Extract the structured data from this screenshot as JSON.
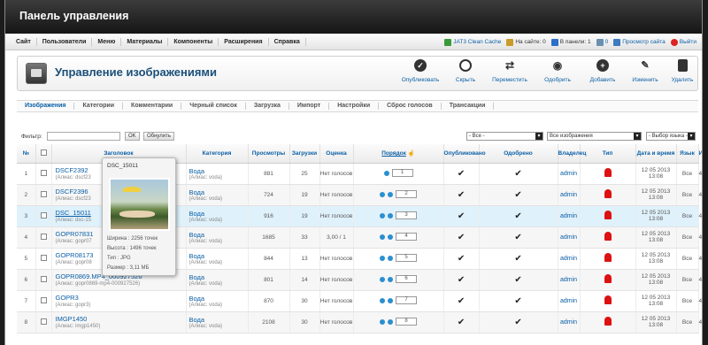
{
  "topbar_title": "Панель управления",
  "menu": [
    "Сайт",
    "Пользователи",
    "Меню",
    "Материалы",
    "Компоненты",
    "Расширения",
    "Справка"
  ],
  "status": {
    "cache": "JAT3 Clean Cache",
    "on_site": "На сайте: 0",
    "in_panel": "В панели: 1",
    "messages": "0",
    "view_site": "Просмотр сайта",
    "logout": "Выйти"
  },
  "page_title": "Управление изображениями",
  "toolbar": {
    "publish": "Опубликовать",
    "hide": "Скрыть",
    "move": "Переместить",
    "approve": "Одобрить",
    "add": "Добавить",
    "edit": "Изменить",
    "delete": "Удалить"
  },
  "subnav": [
    "Изображения",
    "Категории",
    "Комментарии",
    "Черный список",
    "Загрузка",
    "Импорт",
    "Настройки",
    "Сброс голосов",
    "Трансакции"
  ],
  "filter": {
    "label": "Фильтр:",
    "ok": "OK",
    "reset": "Обнулить",
    "sel_all": "- Все -",
    "sel_images": "Все изображения",
    "sel_lang": "- Выбор языка -"
  },
  "columns": {
    "num": "№",
    "title": "Заголовок",
    "category": "Категория",
    "views": "Просмотры",
    "downloads": "Загрузки",
    "rating": "Оценка",
    "order": "Порядок",
    "published": "Опубликовано",
    "approved": "Одобрено",
    "owner": "Владелец",
    "type": "Тип",
    "datetime": "Дата и время",
    "lang": "Язык",
    "id": "ИД"
  },
  "rows": [
    {
      "n": "1",
      "title": "DSCF2392",
      "alias": "(Алиас: dscf23",
      "cat": "Вода",
      "cal": "(Алиас: voda)",
      "views": "881",
      "dl": "25",
      "rating": "Нет голосов",
      "order": "1",
      "owner": "admin",
      "date": "12 05 2013 13:08",
      "lang": "Все",
      "id": "4626"
    },
    {
      "n": "2",
      "title": "DSCF2396",
      "alias": "(Алиас: dscf23",
      "cat": "Вода",
      "cal": "(Алиас: voda)",
      "views": "724",
      "dl": "19",
      "rating": "Нет голосов",
      "order": "2",
      "owner": "admin",
      "date": "12 05 2013 13:08",
      "lang": "Все",
      "id": "4627"
    },
    {
      "n": "3",
      "title": "DSC_15011",
      "alias": "(Алиас: dsc-15",
      "cat": "Вода",
      "cal": "(Алиас: voda)",
      "views": "916",
      "dl": "19",
      "rating": "Нет голосов",
      "order": "3",
      "owner": "admin",
      "date": "12 05 2013 13:08",
      "lang": "Все",
      "id": "4628"
    },
    {
      "n": "4",
      "title": "GOPR07831",
      "alias": "(Алиас: gopr07",
      "cat": "Вода",
      "cal": "(Алиас: voda)",
      "views": "1685",
      "dl": "33",
      "rating": "3,00 / 1",
      "order": "4",
      "owner": "admin",
      "date": "12 05 2013 13:08",
      "lang": "Все",
      "id": "4629"
    },
    {
      "n": "5",
      "title": "GOPR08173",
      "alias": "(Алиас: gopr08",
      "cat": "Вода",
      "cal": "(Алиас: voda)",
      "views": "844",
      "dl": "13",
      "rating": "Нет голосов",
      "order": "5",
      "owner": "admin",
      "date": "12 05 2013 13:08",
      "lang": "Все",
      "id": "4630"
    },
    {
      "n": "6",
      "title": "GOPR0869.MP4_000927526",
      "alias": "(Алиас: gopr0869-mp4-000927526)",
      "cat": "Вода",
      "cal": "(Алиас: voda)",
      "views": "801",
      "dl": "14",
      "rating": "Нет голосов",
      "order": "6",
      "owner": "admin",
      "date": "12 05 2013 13:08",
      "lang": "Все",
      "id": "4631"
    },
    {
      "n": "7",
      "title": "GOPR3",
      "alias": "(Алиас: gopr3)",
      "cat": "Вода",
      "cal": "(Алиас: voda)",
      "views": "870",
      "dl": "30",
      "rating": "Нет голосов",
      "order": "7",
      "owner": "admin",
      "date": "12 05 2013 13:08",
      "lang": "Все",
      "id": "4632"
    },
    {
      "n": "8",
      "title": "IMGP1450",
      "alias": "(Алиас: imgp1450)",
      "cat": "Вода",
      "cal": "(Алиас: voda)",
      "views": "2108",
      "dl": "30",
      "rating": "Нет голосов",
      "order": "8",
      "owner": "admin",
      "date": "12 05 2013 13:08",
      "lang": "Все",
      "id": "4633"
    }
  ],
  "popup": {
    "name": "DSC_15011",
    "width": "Ширина : 2256 точек",
    "height": "Высота : 1496 точек",
    "type": "Тип      : JPG",
    "size": "Размер  : 3,11 МБ"
  }
}
